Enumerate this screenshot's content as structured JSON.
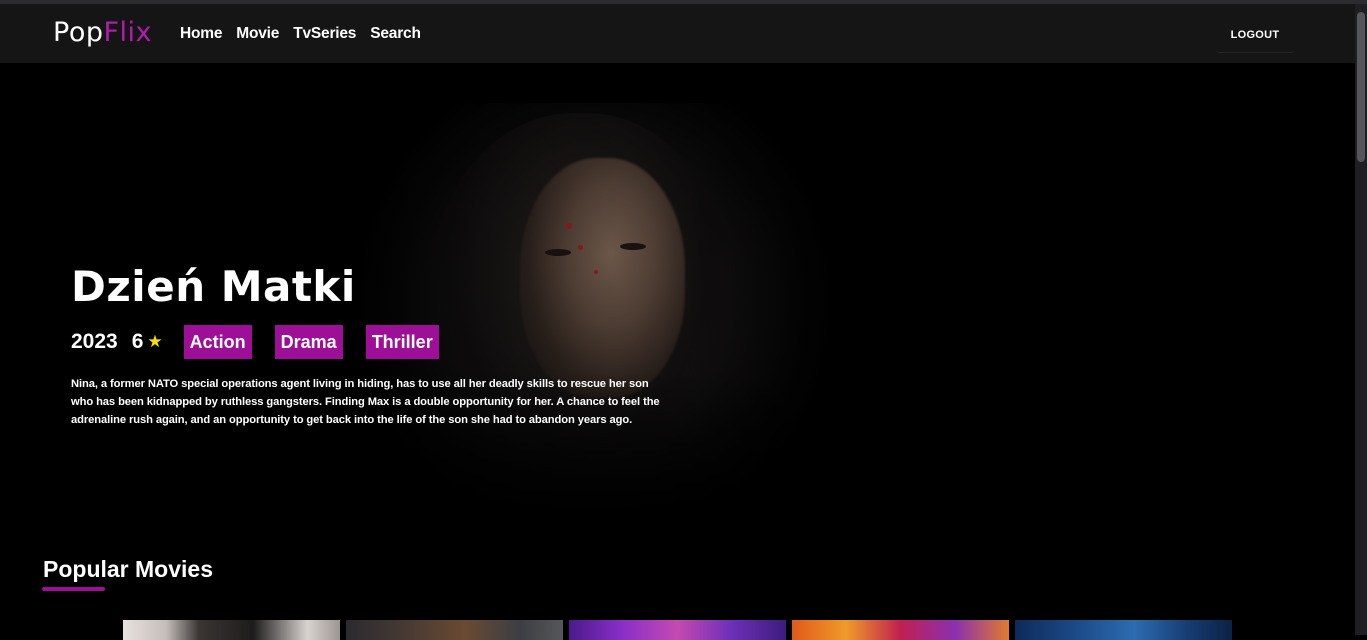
{
  "brand": {
    "part1": "Pop",
    "part2": "Flix",
    "accent_color": "#b21bb0"
  },
  "nav": {
    "links": [
      {
        "label": "Home"
      },
      {
        "label": "Movie"
      },
      {
        "label": "TvSeries"
      },
      {
        "label": "Search"
      }
    ],
    "logout_label": "LOGOUT"
  },
  "hero": {
    "title": "Dzień Matki",
    "year": "2023",
    "rating": "6",
    "star_icon": "★",
    "genres": [
      "Action",
      "Drama",
      "Thriller"
    ],
    "genre_color": "#9d0f96",
    "overview": "Nina, a former NATO special operations agent living in hiding, has to use all her deadly skills to rescue her son who has been kidnapped by ruthless gangsters. Finding Max is a double opportunity for her. A chance to feel the adrenaline rush again, and an opportunity to get back into the life of the son she had to abandon years ago."
  },
  "sections": {
    "popular_movies": {
      "title": "Popular Movies"
    }
  }
}
